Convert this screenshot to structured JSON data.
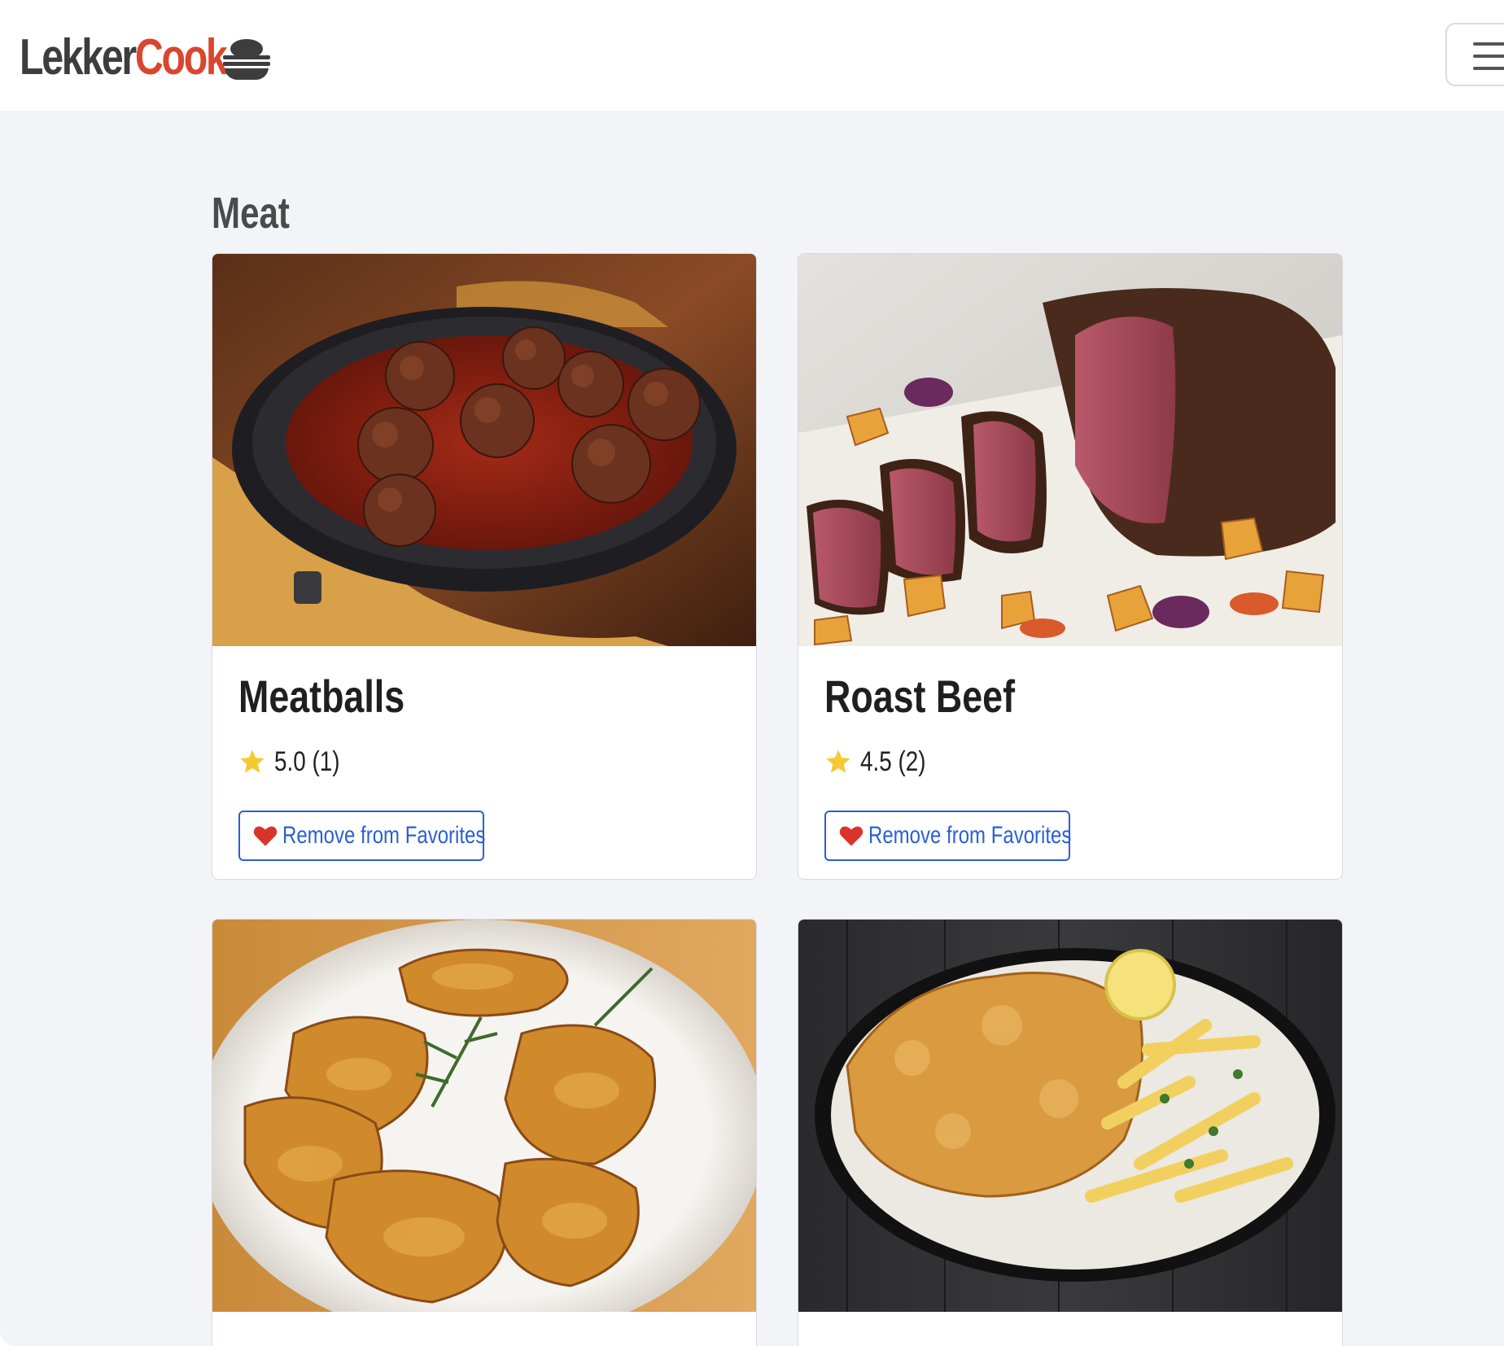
{
  "brand": {
    "name_part1": "Lekker",
    "name_part2": "Cook",
    "icon": "bowl-icon",
    "accent_color": "#d9462e"
  },
  "navbar": {
    "toggle_icon": "hamburger-menu-icon"
  },
  "section": {
    "title": "Meat"
  },
  "recipes": [
    {
      "name": "Meatballs",
      "image": "meatballs-in-tomato-sauce-photo",
      "rating": "5.0 (1)",
      "favorite_label": "Remove from Favorites"
    },
    {
      "name": "Roast Beef",
      "image": "sliced-roast-beef-with-potatoes-photo",
      "rating": "4.5 (2)",
      "favorite_label": "Remove from Favorites"
    },
    {
      "name": "",
      "image": "roasted-chicken-wings-photo"
    },
    {
      "name": "",
      "image": "breaded-schnitzel-with-fries-photo"
    }
  ],
  "colors": {
    "link_blue": "#2a5fd6",
    "heart_red": "#d9342b",
    "star_yellow": "#f6c833",
    "background": "#f3f4f7"
  }
}
